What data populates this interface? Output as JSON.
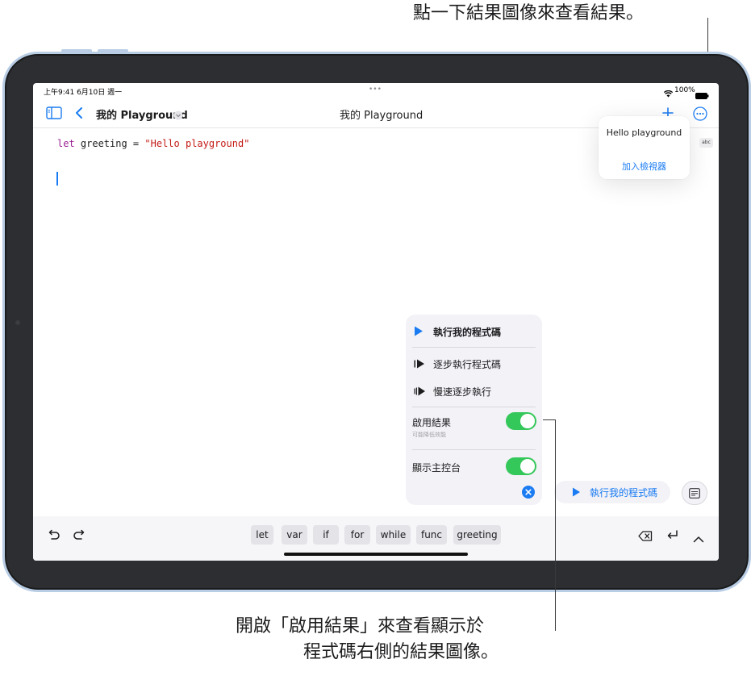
{
  "callouts": {
    "top": "點一下結果圖像來查看結果。",
    "bottom_line1": "開啟「啟用結果」來查看顯示於",
    "bottom_line2": "程式碼右側的結果圖像。"
  },
  "status_bar": {
    "time_date": "上午9:41  6月10日 週一",
    "dots": "•••",
    "battery": "100%"
  },
  "nav": {
    "title_left": "我的 Playground",
    "title_center": "我的 Playground"
  },
  "editor": {
    "code": {
      "keyword": "let",
      "identifier": " greeting = ",
      "string": "\"Hello playground\""
    }
  },
  "result_popover": {
    "value": "Hello playground",
    "add_to_viewer": "加入檢視器",
    "badge": "abc"
  },
  "run_menu": {
    "run_code": "執行我的程式碼",
    "step_through": "逐步執行程式碼",
    "step_slowly": "慢速逐步執行",
    "enable_results": "啟用結果",
    "enable_results_hint": "可能降低效能",
    "show_console": "顯示主控台",
    "enable_results_on": true,
    "show_console_on": true
  },
  "run_pill": {
    "label": "執行我的程式碼"
  },
  "toolbar": {
    "chips": [
      "let",
      "var",
      "if",
      "for",
      "while",
      "func",
      "greeting"
    ]
  },
  "colors": {
    "accent": "#1a7bf2",
    "toggle_on": "#34c759",
    "frame": "#2c2e31",
    "frame_edge": "#b9cde4",
    "keyword": "#9b2393",
    "string": "#c41a16"
  }
}
